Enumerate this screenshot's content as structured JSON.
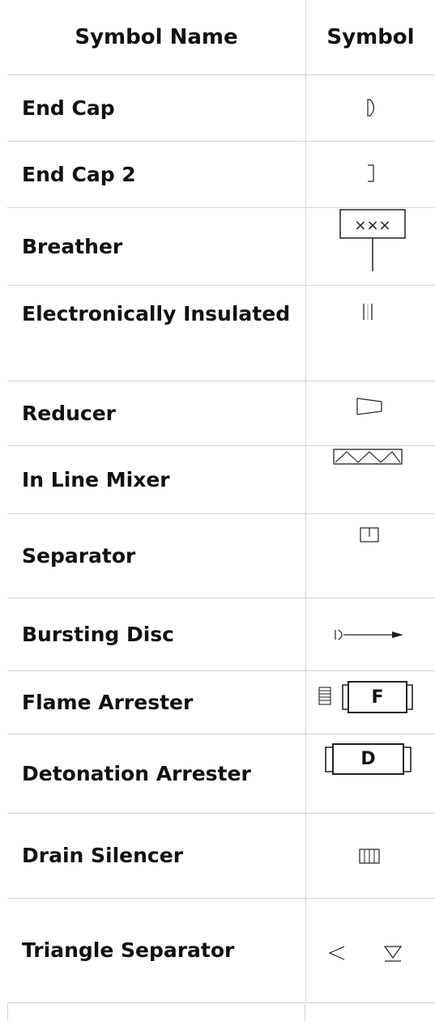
{
  "header": {
    "name_label": "Symbol Name",
    "symbol_label": "Symbol"
  },
  "rows": [
    {
      "name": "End Cap",
      "icon": "end-cap-icon"
    },
    {
      "name": "End Cap 2",
      "icon": "end-cap-2-icon"
    },
    {
      "name": "Breather",
      "icon": "breather-icon"
    },
    {
      "name": "Electronically Insulated",
      "icon": "electronically-insulated-icon"
    },
    {
      "name": "Reducer",
      "icon": "reducer-icon"
    },
    {
      "name": "In Line Mixer",
      "icon": "in-line-mixer-icon"
    },
    {
      "name": "Separator",
      "icon": "separator-icon"
    },
    {
      "name": "Bursting Disc",
      "icon": "bursting-disc-icon"
    },
    {
      "name": "Flame Arrester",
      "icon": "flame-arrester-icon",
      "letter": "F"
    },
    {
      "name": "Detonation Arrester",
      "icon": "detonation-arrester-icon",
      "letter": "D"
    },
    {
      "name": "Drain Silencer",
      "icon": "drain-silencer-icon"
    },
    {
      "name": "Triangle Separator",
      "icon": "triangle-separator-icon"
    }
  ]
}
